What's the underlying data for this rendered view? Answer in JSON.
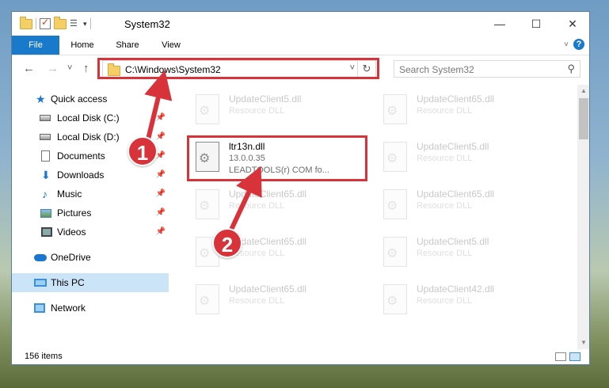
{
  "window": {
    "title": "System32",
    "minimize_glyph": "—",
    "maximize_glyph": "☐",
    "close_glyph": "✕"
  },
  "ribbon": {
    "tabs": [
      "File",
      "Home",
      "Share",
      "View"
    ],
    "help": "?"
  },
  "navigation": {
    "back_glyph": "←",
    "forward_glyph": "→",
    "recent_glyph": "˅",
    "up_glyph": "↑",
    "address": "C:\\Windows\\System32",
    "address_dropdown": "˅",
    "refresh_glyph": "↻",
    "search_placeholder": "Search System32",
    "search_glyph": "⚲"
  },
  "sidebar": {
    "items": [
      {
        "label": "Quick access",
        "icon": "star-icon"
      },
      {
        "label": "Local Disk (C:)",
        "icon": "drive-icon",
        "pinned": true
      },
      {
        "label": "Local Disk (D:)",
        "icon": "drive-icon",
        "pinned": true
      },
      {
        "label": "Documents",
        "icon": "document-icon",
        "pinned": true
      },
      {
        "label": "Downloads",
        "icon": "download-icon",
        "pinned": true
      },
      {
        "label": "Music",
        "icon": "music-icon",
        "pinned": true
      },
      {
        "label": "Pictures",
        "icon": "picture-icon",
        "pinned": true
      },
      {
        "label": "Videos",
        "icon": "video-icon",
        "pinned": true
      },
      {
        "label": "OneDrive",
        "icon": "cloud-icon"
      },
      {
        "label": "This PC",
        "icon": "computer-icon",
        "selected": true
      },
      {
        "label": "Network",
        "icon": "network-icon"
      }
    ],
    "pin_glyph": "📌"
  },
  "files": [
    {
      "name": "UpdateClient5.dll",
      "type": "Resource DLL"
    },
    {
      "name": "UpdateClient65.dll",
      "type": "Resource DLL"
    },
    {
      "name": "ltr13n.dll",
      "version": "13.0.0.35",
      "description": "LEADTOOLS(r) COM fo...",
      "highlighted": true
    },
    {
      "name": "UpdateClient5.dll",
      "type": "Resource DLL"
    },
    {
      "name": "UpdateClient65.dll",
      "type": "Resource DLL"
    },
    {
      "name": "UpdateClient65.dll",
      "type": "Resource DLL"
    },
    {
      "name": "UpdateClient65.dll",
      "type": "Resource DLL"
    },
    {
      "name": "UpdateClient5.dll",
      "type": "Resource DLL"
    },
    {
      "name": "UpdateClient65.dll",
      "type": "Resource DLL"
    },
    {
      "name": "UpdateClient42.dll",
      "type": "Resource DLL"
    }
  ],
  "status": {
    "item_count": "156 items"
  },
  "annotations": {
    "step1": "1",
    "step2": "2"
  },
  "colors": {
    "accent": "#1979ca",
    "highlight_red": "#d8333b",
    "selection": "#cce4f7"
  }
}
